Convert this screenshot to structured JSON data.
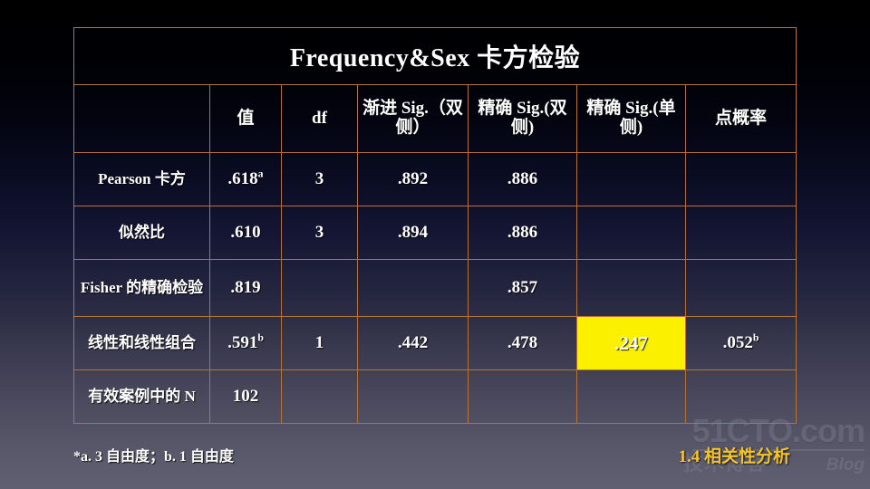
{
  "slide": {
    "title": "Frequency&Sex 卡方检验",
    "footnote": "*a. 3 自由度；b. 1 自由度",
    "section_label": "1.4 相关性分析",
    "accent_color": "#f4c52a",
    "highlight_color": "#fbf000",
    "border_color": "#b5723a"
  },
  "watermark": {
    "main": "51CTO.com",
    "cn": "技术博客",
    "blog": "Blog"
  },
  "table": {
    "headers": [
      "",
      "值",
      "df",
      "渐进 Sig.（双侧）",
      "精确 Sig.(双侧)",
      "精确 Sig.(单侧)",
      "点概率"
    ],
    "rows": [
      {
        "label": "Pearson 卡方",
        "cells": [
          {
            "text": ".618",
            "sup": "a"
          },
          {
            "text": "3"
          },
          {
            "text": ".892"
          },
          {
            "text": ".886"
          },
          {
            "text": ""
          },
          {
            "text": ""
          }
        ]
      },
      {
        "label": "似然比",
        "cells": [
          {
            "text": ".610"
          },
          {
            "text": "3"
          },
          {
            "text": ".894"
          },
          {
            "text": ".886"
          },
          {
            "text": ""
          },
          {
            "text": ""
          }
        ]
      },
      {
        "label": "Fisher 的精确检验",
        "cells": [
          {
            "text": ".819"
          },
          {
            "text": ""
          },
          {
            "text": ""
          },
          {
            "text": ".857"
          },
          {
            "text": ""
          },
          {
            "text": ""
          }
        ]
      },
      {
        "label": "线性和线性组合",
        "cells": [
          {
            "text": ".591",
            "sup": "b"
          },
          {
            "text": "1"
          },
          {
            "text": ".442"
          },
          {
            "text": ".478"
          },
          {
            "text": ".247",
            "highlight": true
          },
          {
            "text": ".052",
            "sup": "b"
          }
        ]
      },
      {
        "label": "有效案例中的 N",
        "cells": [
          {
            "text": "102"
          },
          {
            "text": ""
          },
          {
            "text": ""
          },
          {
            "text": ""
          },
          {
            "text": ""
          },
          {
            "text": ""
          }
        ]
      }
    ]
  }
}
